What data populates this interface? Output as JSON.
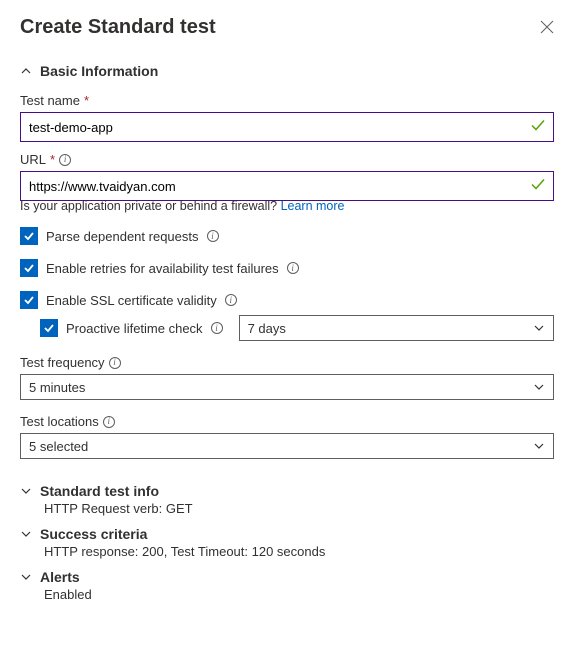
{
  "header": {
    "title": "Create Standard test"
  },
  "sections": {
    "basic": {
      "title": "Basic Information"
    },
    "std": {
      "title": "Standard test info",
      "sub": "HTTP Request verb: GET"
    },
    "succ": {
      "title": "Success criteria",
      "sub": "HTTP response: 200, Test Timeout: 120 seconds"
    },
    "alerts": {
      "title": "Alerts",
      "sub": "Enabled"
    }
  },
  "fields": {
    "testName": {
      "label": "Test name",
      "value": "test-demo-app"
    },
    "url": {
      "label": "URL",
      "value": "https://www.tvaidyan.com"
    },
    "helper": {
      "text": "Is your application private or behind a firewall? ",
      "link": "Learn more"
    },
    "parse": {
      "label": "Parse dependent requests"
    },
    "retries": {
      "label": "Enable retries for availability test failures"
    },
    "ssl": {
      "label": "Enable SSL certificate validity"
    },
    "proactive": {
      "label": "Proactive lifetime check",
      "select": "7 days"
    },
    "freq": {
      "label": "Test frequency",
      "select": "5 minutes"
    },
    "loc": {
      "label": "Test locations",
      "select": "5 selected"
    }
  }
}
